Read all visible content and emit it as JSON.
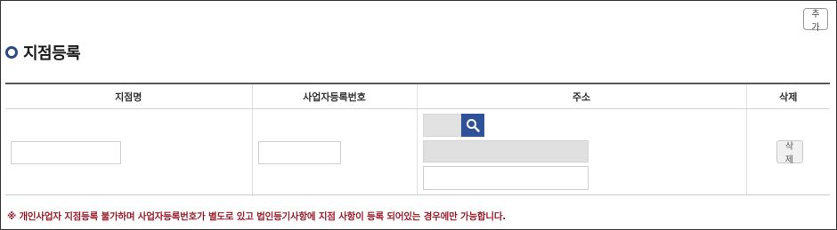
{
  "toolbar": {
    "add_label": "추가"
  },
  "section": {
    "title": "지점등록"
  },
  "table": {
    "headers": [
      "지점명",
      "사업자등록번호",
      "주소",
      "삭제"
    ],
    "row": {
      "delete_label": "삭제"
    }
  },
  "notice": "※ 개인사업자 지점등록 불가하며 사업자등록번호가 별도로 있고 법인등기사항에 지점 사항이 등록 되어있는 경우에만 가능합니다.",
  "colors": {
    "accent": "#2f5197",
    "notice": "#9b1c2a"
  }
}
